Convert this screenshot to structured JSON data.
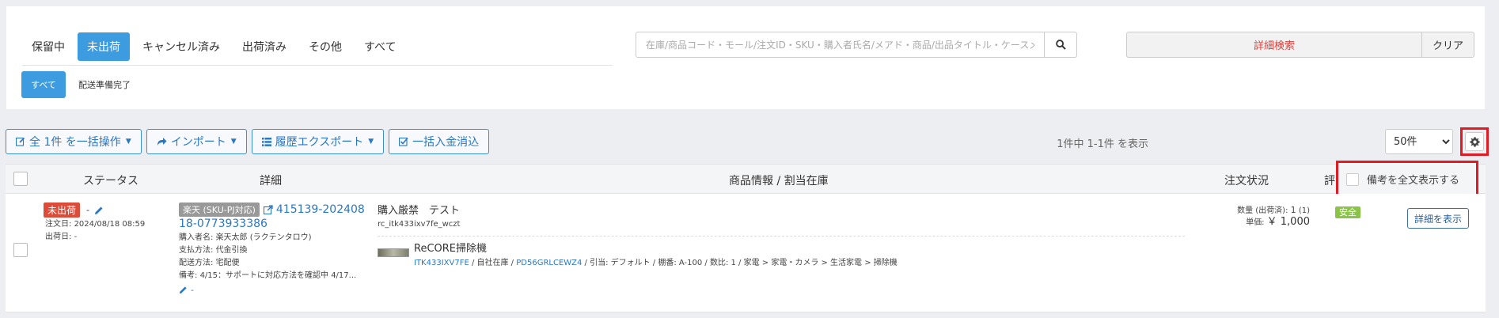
{
  "status_tabs": [
    {
      "label": "保留中",
      "active": false
    },
    {
      "label": "未出荷",
      "active": true
    },
    {
      "label": "キャンセル済み",
      "active": false
    },
    {
      "label": "出荷済み",
      "active": false
    },
    {
      "label": "その他",
      "active": false
    },
    {
      "label": "すべて",
      "active": false
    }
  ],
  "sub_tabs": [
    {
      "label": "すべて",
      "active": true
    },
    {
      "label": "配送準備完了",
      "active": false
    }
  ],
  "search": {
    "placeholder": "在庫/商品コード・モール/注文ID・SKU・購入者氏名/メアド・商品/出品タイトル・ケースメモで検索",
    "icon": "search-icon"
  },
  "advanced_search": {
    "label": "詳細検索",
    "clear_label": "クリア"
  },
  "toolbar": {
    "bulk_label": "全 1件 を一括操作",
    "import_label": "インポート",
    "export_label": "履歴エクスポート",
    "payment_label": "一括入金消込"
  },
  "paging": {
    "summary": "1件中 1-1件 を表示",
    "per_page": "50件"
  },
  "memo_toggle_label": "備考を全文表示する",
  "table": {
    "headers": {
      "status": "ステータス",
      "detail": "詳細",
      "product": "商品情報 / 割当在庫",
      "order_status": "注文状況",
      "extra": "評"
    }
  },
  "order": {
    "status_badge": "未出荷",
    "status_dash": "-",
    "order_date_label": "注文日:",
    "order_date": "2024/08/18 08:59",
    "ship_date_label": "出荷日:",
    "ship_date": "-",
    "mall_badge": "楽天 (SKU-PJ対応)",
    "order_id_line1": "415139-202408",
    "order_id_line2": "18-0773933386",
    "buyer_label": "購入者名:",
    "buyer": "楽天太郎 (ラクテンタロウ)",
    "payment_label": "支払方法:",
    "payment": "代金引換",
    "delivery_label": "配送方法:",
    "delivery": "宅配便",
    "memo_label": "備考:",
    "memo": "4/15：サポートに対応方法を確認中 4/17...",
    "edit_dash": "-",
    "product_title": "購入厳禁　テスト",
    "product_code": "rc_itk433ixv7fe_wczt",
    "item_name": "ReCORE掃除機",
    "item_sku": "ITK433IXV7FE",
    "item_sep1": " / 自社在庫 / ",
    "item_stock": "PD56GRLCEWZ4",
    "item_detail": " / 引当: デフォルト / 棚番: A-100 / 数比: 1 / 家電 > 家電・カメラ > 生活家電 > 掃除機",
    "qty_label": "数量 (出荷済):",
    "qty_value": "1",
    "qty_shipped": "(1)",
    "price_label": "単価:",
    "price_value": "￥ 1,000",
    "safety_badge": "安全",
    "detail_button": "詳細を表示"
  },
  "colors": {
    "accent": "#3d9be0",
    "danger": "#dd4b39",
    "highlight_box": "#e01b24",
    "safe": "#8bc34a"
  }
}
